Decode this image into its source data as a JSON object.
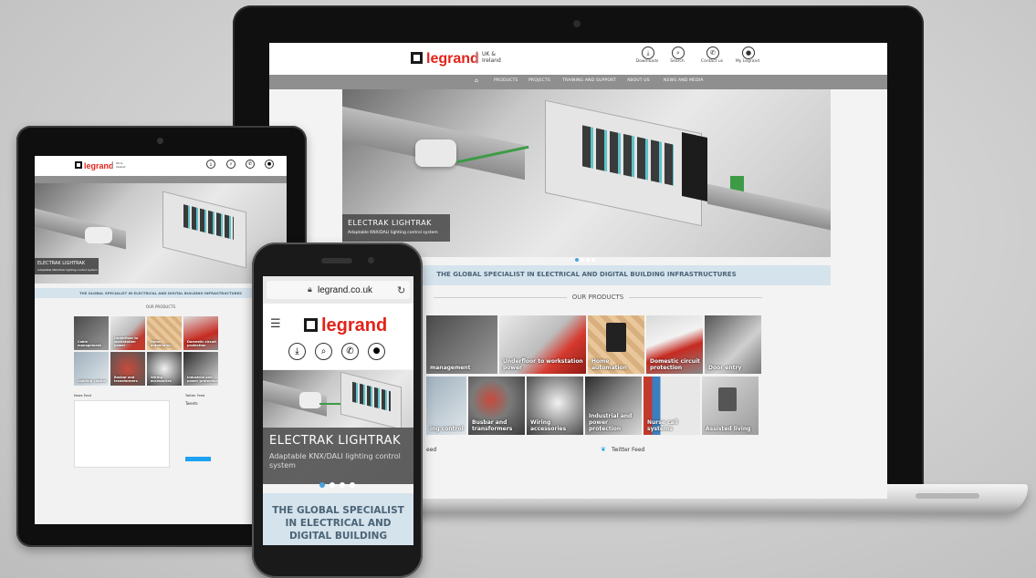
{
  "site": {
    "brand": "legrand",
    "brand_sub": [
      "UK &",
      "Ireland"
    ],
    "url": "legrand.co.uk"
  },
  "header_icons": [
    {
      "label": "Downloads",
      "icon": "download-icon",
      "glyph": "⤓"
    },
    {
      "label": "Search",
      "icon": "search-icon",
      "glyph": "⌕"
    },
    {
      "label": "Contact us",
      "icon": "phone-icon",
      "glyph": "✆"
    },
    {
      "label": "My Legrand",
      "icon": "user-icon",
      "glyph": "●"
    }
  ],
  "nav": [
    "PRODUCTS",
    "PROJECTS",
    "TRAINING AND SUPPORT",
    "ABOUT US",
    "NEWS AND MEDIA"
  ],
  "hero": {
    "title": "ELECTRAK LIGHTRAK",
    "subtitle": "Adaptable KNX/DALI lighting control system"
  },
  "strapline": "THE GLOBAL SPECIALIST IN ELECTRICAL AND DIGITAL BUILDING INFRASTRUCTURES",
  "phone_strapline": "THE GLOBAL SPECIALIST IN ELECTRICAL AND DIGITAL BUILDING",
  "section_title": "OUR PRODUCTS",
  "products_row1": [
    "Cable management",
    "Underfloor to workstation power",
    "Home automation",
    "Domestic circuit protection",
    "Door entry"
  ],
  "products_row2": [
    "Lighting control",
    "Busbar and transformers",
    "Wiring accessories",
    "Industrial and power protection",
    "Nurse call systems",
    "Assisted living"
  ],
  "laptop_row1_visible": [
    "management",
    "Underfloor to workstation power",
    "Home automation",
    "Domestic circuit protection",
    "Door entry"
  ],
  "laptop_row2_visible": [
    "ing control",
    "Busbar and transformers",
    "Wiring accessories",
    "Industrial and power protection",
    "Nurse call systems",
    "Assisted living"
  ],
  "feeds": {
    "news": "News Feed",
    "news_cut": "eed",
    "twitter": "Twitter Feed",
    "tweets": "Tweets"
  },
  "colors": {
    "brand_red": "#e2231a",
    "nav_grey": "#8f8f8f",
    "strap_blue": "#d5e3ed",
    "twitter_blue": "#1da1f2"
  }
}
